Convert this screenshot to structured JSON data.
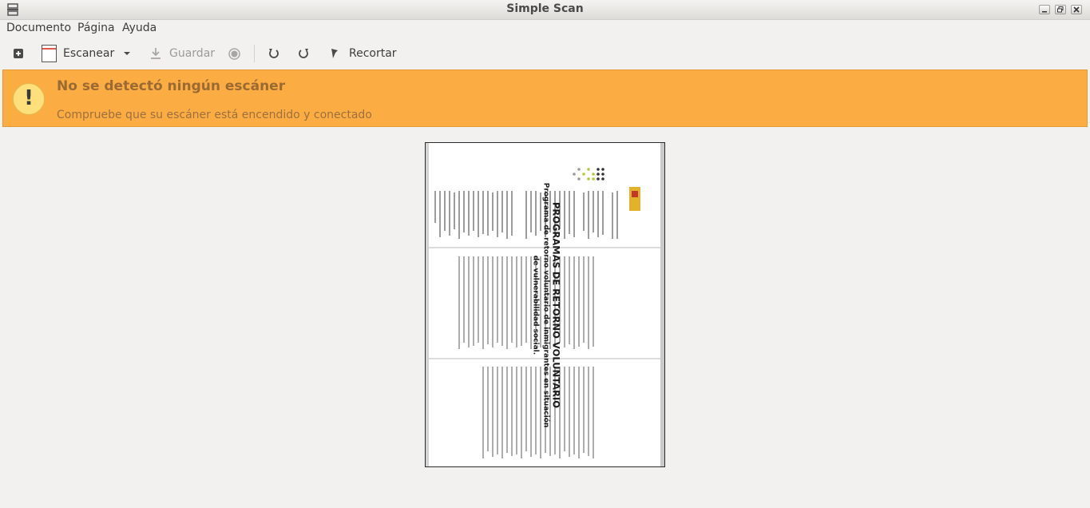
{
  "window": {
    "title": "Simple Scan"
  },
  "menu": {
    "items": [
      "Documento",
      "Página",
      "Ayuda"
    ]
  },
  "toolbar": {
    "scan_label": "Escanear",
    "save_label": "Guardar",
    "crop_label": "Recortar"
  },
  "infobar": {
    "title": "No se detectó ningún escáner",
    "message": "Compruebe que su escáner está encendido y conectado",
    "color": "#fbad44"
  },
  "document": {
    "heading": "PROGRAMAS DE RETORNO VOLUNTARIO",
    "subheading_line1": "Programa de retorno voluntario de inmigrantes en situación",
    "subheading_line2": "de vulnerabilidad social."
  }
}
